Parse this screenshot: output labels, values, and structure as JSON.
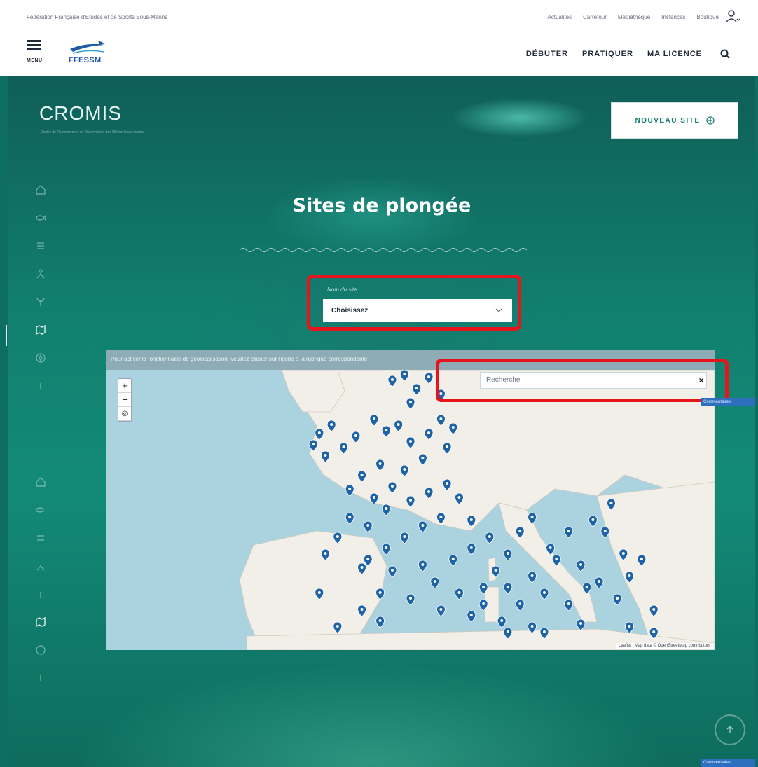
{
  "topbar": {
    "federation": "Fédération Française d'Etudes et de Sports Sous-Marins",
    "links": [
      "Actualités",
      "Carrefour",
      "Médiathèque",
      "Instances",
      "Boutique"
    ]
  },
  "header": {
    "menu_label": "MENU",
    "logo_text": "FFESSM",
    "nav": [
      "DÉBUTER",
      "PRATIQUER",
      "MA LICENCE"
    ]
  },
  "hero": {
    "brand": "CROMIS",
    "brand_sub": "Centre de Recensement en Observatoire des Milieux Sous-marins",
    "new_site_label": "NOUVEAU SITE",
    "title": "Sites de plongée"
  },
  "site_select": {
    "label": "Nom du site",
    "value": "Choisissez"
  },
  "map": {
    "hint": "Pour activer la fonctionnalité de géolocalisation, veuillez cliquer sur l'icône à la rubrique correspondante",
    "search_placeholder": "Recherche",
    "clear": "×",
    "zoom_in": "+",
    "zoom_out": "−",
    "attribution": "Leaflet | Map data © OpenStreetMap contributors",
    "markers": [
      [
        0.47,
        0.06
      ],
      [
        0.49,
        0.04
      ],
      [
        0.51,
        0.09
      ],
      [
        0.53,
        0.05
      ],
      [
        0.55,
        0.11
      ],
      [
        0.5,
        0.14
      ],
      [
        0.37,
        0.22
      ],
      [
        0.35,
        0.25
      ],
      [
        0.34,
        0.29
      ],
      [
        0.36,
        0.33
      ],
      [
        0.39,
        0.3
      ],
      [
        0.41,
        0.26
      ],
      [
        0.44,
        0.2
      ],
      [
        0.46,
        0.24
      ],
      [
        0.48,
        0.22
      ],
      [
        0.5,
        0.28
      ],
      [
        0.53,
        0.25
      ],
      [
        0.55,
        0.2
      ],
      [
        0.57,
        0.23
      ],
      [
        0.56,
        0.3
      ],
      [
        0.52,
        0.34
      ],
      [
        0.49,
        0.38
      ],
      [
        0.45,
        0.36
      ],
      [
        0.42,
        0.4
      ],
      [
        0.4,
        0.45
      ],
      [
        0.44,
        0.48
      ],
      [
        0.46,
        0.52
      ],
      [
        0.5,
        0.49
      ],
      [
        0.53,
        0.46
      ],
      [
        0.56,
        0.43
      ],
      [
        0.58,
        0.48
      ],
      [
        0.55,
        0.55
      ],
      [
        0.52,
        0.58
      ],
      [
        0.49,
        0.62
      ],
      [
        0.46,
        0.66
      ],
      [
        0.43,
        0.7
      ],
      [
        0.4,
        0.55
      ],
      [
        0.38,
        0.62
      ],
      [
        0.36,
        0.68
      ],
      [
        0.42,
        0.73
      ],
      [
        0.47,
        0.74
      ],
      [
        0.52,
        0.72
      ],
      [
        0.57,
        0.7
      ],
      [
        0.6,
        0.66
      ],
      [
        0.63,
        0.62
      ],
      [
        0.66,
        0.68
      ],
      [
        0.64,
        0.74
      ],
      [
        0.62,
        0.8
      ],
      [
        0.66,
        0.8
      ],
      [
        0.7,
        0.76
      ],
      [
        0.72,
        0.82
      ],
      [
        0.68,
        0.86
      ],
      [
        0.73,
        0.66
      ],
      [
        0.76,
        0.6
      ],
      [
        0.74,
        0.7
      ],
      [
        0.78,
        0.72
      ],
      [
        0.79,
        0.8
      ],
      [
        0.76,
        0.86
      ],
      [
        0.81,
        0.78
      ],
      [
        0.84,
        0.84
      ],
      [
        0.82,
        0.6
      ],
      [
        0.85,
        0.68
      ],
      [
        0.88,
        0.7
      ],
      [
        0.86,
        0.76
      ],
      [
        0.9,
        0.88
      ],
      [
        0.78,
        0.93
      ],
      [
        0.7,
        0.94
      ],
      [
        0.65,
        0.92
      ],
      [
        0.6,
        0.9
      ],
      [
        0.55,
        0.88
      ],
      [
        0.5,
        0.84
      ],
      [
        0.45,
        0.82
      ],
      [
        0.42,
        0.88
      ],
      [
        0.38,
        0.94
      ],
      [
        0.35,
        0.82
      ],
      [
        0.45,
        0.92
      ],
      [
        0.54,
        0.78
      ],
      [
        0.58,
        0.82
      ],
      [
        0.62,
        0.86
      ],
      [
        0.66,
        0.96
      ],
      [
        0.72,
        0.96
      ],
      [
        0.86,
        0.94
      ],
      [
        0.9,
        0.96
      ],
      [
        0.83,
        0.5
      ],
      [
        0.8,
        0.56
      ],
      [
        0.7,
        0.55
      ],
      [
        0.68,
        0.6
      ],
      [
        0.6,
        0.56
      ],
      [
        0.47,
        0.44
      ],
      [
        0.43,
        0.58
      ]
    ]
  },
  "side_tab": "Commentaires",
  "colors": {
    "teal": "#11806f",
    "marker": "#1e63a6",
    "highlight": "#e8141b",
    "brand_blue": "#1e5aa8"
  }
}
